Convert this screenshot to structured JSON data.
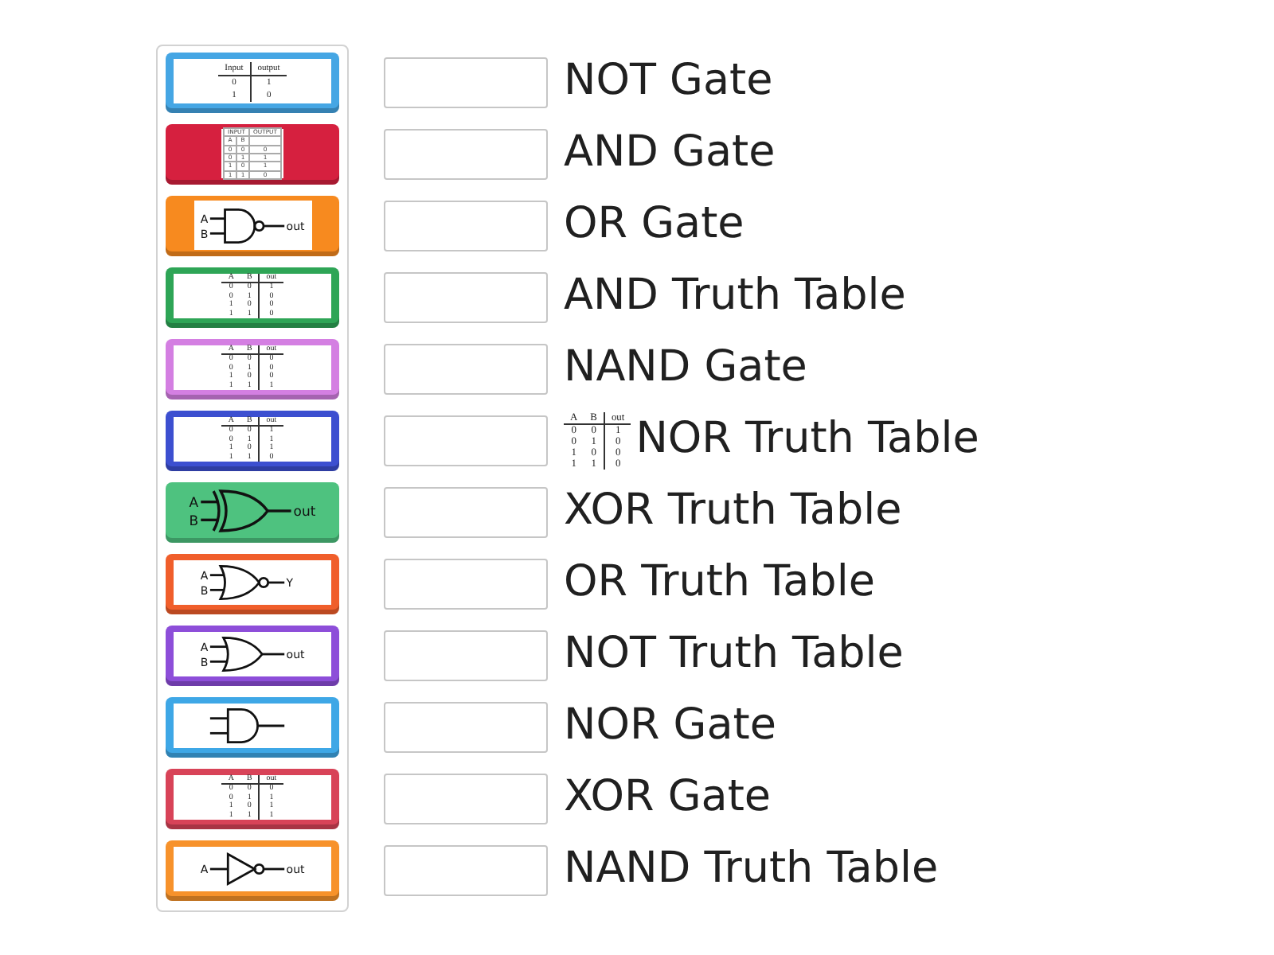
{
  "tiles": [
    {
      "color": "#45a6e4",
      "kind": "framed",
      "picture": {
        "kind": "ruled_table",
        "columns": [
          "Input",
          "output"
        ],
        "rows": [
          [
            "0",
            "1"
          ],
          [
            "1",
            "0"
          ]
        ]
      }
    },
    {
      "color": "#d6203f",
      "kind": "inset",
      "picture": {
        "kind": "grid_table",
        "column_groups": [
          "INPUT",
          "OUTPUT"
        ],
        "columns": [
          "A",
          "B"
        ],
        "rows": [
          [
            "0",
            "0",
            "0"
          ],
          [
            "0",
            "1",
            "1"
          ],
          [
            "1",
            "0",
            "1"
          ],
          [
            "1",
            "1",
            "0"
          ]
        ]
      }
    },
    {
      "color": "#f78a1f",
      "kind": "inset",
      "picture": {
        "kind": "nand_gate",
        "inputs": [
          "A",
          "B"
        ],
        "output": "out"
      }
    },
    {
      "color": "#2ea556",
      "kind": "framed",
      "picture": {
        "kind": "ruled_table",
        "columns": [
          "A",
          "B",
          "out"
        ],
        "rows": [
          [
            "0",
            "0",
            "1"
          ],
          [
            "0",
            "1",
            "0"
          ],
          [
            "1",
            "0",
            "0"
          ],
          [
            "1",
            "1",
            "0"
          ]
        ]
      }
    },
    {
      "color": "#d47fe2",
      "kind": "framed",
      "picture": {
        "kind": "ruled_table",
        "columns": [
          "A",
          "B",
          "out"
        ],
        "rows": [
          [
            "0",
            "0",
            "0"
          ],
          [
            "0",
            "1",
            "0"
          ],
          [
            "1",
            "0",
            "0"
          ],
          [
            "1",
            "1",
            "1"
          ]
        ]
      }
    },
    {
      "color": "#3c4fd0",
      "kind": "framed",
      "picture": {
        "kind": "ruled_table",
        "columns": [
          "A",
          "B",
          "out"
        ],
        "rows": [
          [
            "0",
            "0",
            "1"
          ],
          [
            "0",
            "1",
            "1"
          ],
          [
            "1",
            "0",
            "1"
          ],
          [
            "1",
            "1",
            "0"
          ]
        ]
      }
    },
    {
      "color": "#4ec27f",
      "kind": "clear",
      "picture": {
        "kind": "xor_gate",
        "inputs": [
          "A",
          "B"
        ],
        "output": "out"
      }
    },
    {
      "color": "#f05e2b",
      "kind": "framed",
      "picture": {
        "kind": "nor_gate",
        "inputs": [
          "A",
          "B"
        ],
        "output": "Y"
      }
    },
    {
      "color": "#8d4ed9",
      "kind": "framed",
      "picture": {
        "kind": "or_gate",
        "inputs": [
          "A",
          "B"
        ],
        "output": "out"
      }
    },
    {
      "color": "#3ea7e6",
      "kind": "framed",
      "picture": {
        "kind": "and_gate"
      }
    },
    {
      "color": "#d84358",
      "kind": "framed",
      "picture": {
        "kind": "ruled_table",
        "columns": [
          "A",
          "B",
          "out"
        ],
        "rows": [
          [
            "0",
            "0",
            "0"
          ],
          [
            "0",
            "1",
            "1"
          ],
          [
            "1",
            "0",
            "1"
          ],
          [
            "1",
            "1",
            "1"
          ]
        ]
      }
    },
    {
      "color": "#f7922b",
      "kind": "framed",
      "picture": {
        "kind": "not_gate",
        "inputs": [
          "A"
        ],
        "output": "out"
      }
    }
  ],
  "targets": [
    {
      "label": "NOT Gate"
    },
    {
      "label": "AND Gate"
    },
    {
      "label": "OR Gate"
    },
    {
      "label": "AND Truth Table"
    },
    {
      "label": "NAND Gate"
    },
    {
      "label": "NOR Truth Table",
      "picture": {
        "kind": "ruled_table",
        "columns": [
          "A",
          "B",
          "out"
        ],
        "rows": [
          [
            "0",
            "0",
            "1"
          ],
          [
            "0",
            "1",
            "0"
          ],
          [
            "1",
            "0",
            "0"
          ],
          [
            "1",
            "1",
            "0"
          ]
        ]
      }
    },
    {
      "label": "XOR Truth Table"
    },
    {
      "label": "OR Truth Table"
    },
    {
      "label": "NOT Truth Table"
    },
    {
      "label": "NOR Gate"
    },
    {
      "label": "XOR Gate"
    },
    {
      "label": "NAND Truth Table"
    }
  ]
}
